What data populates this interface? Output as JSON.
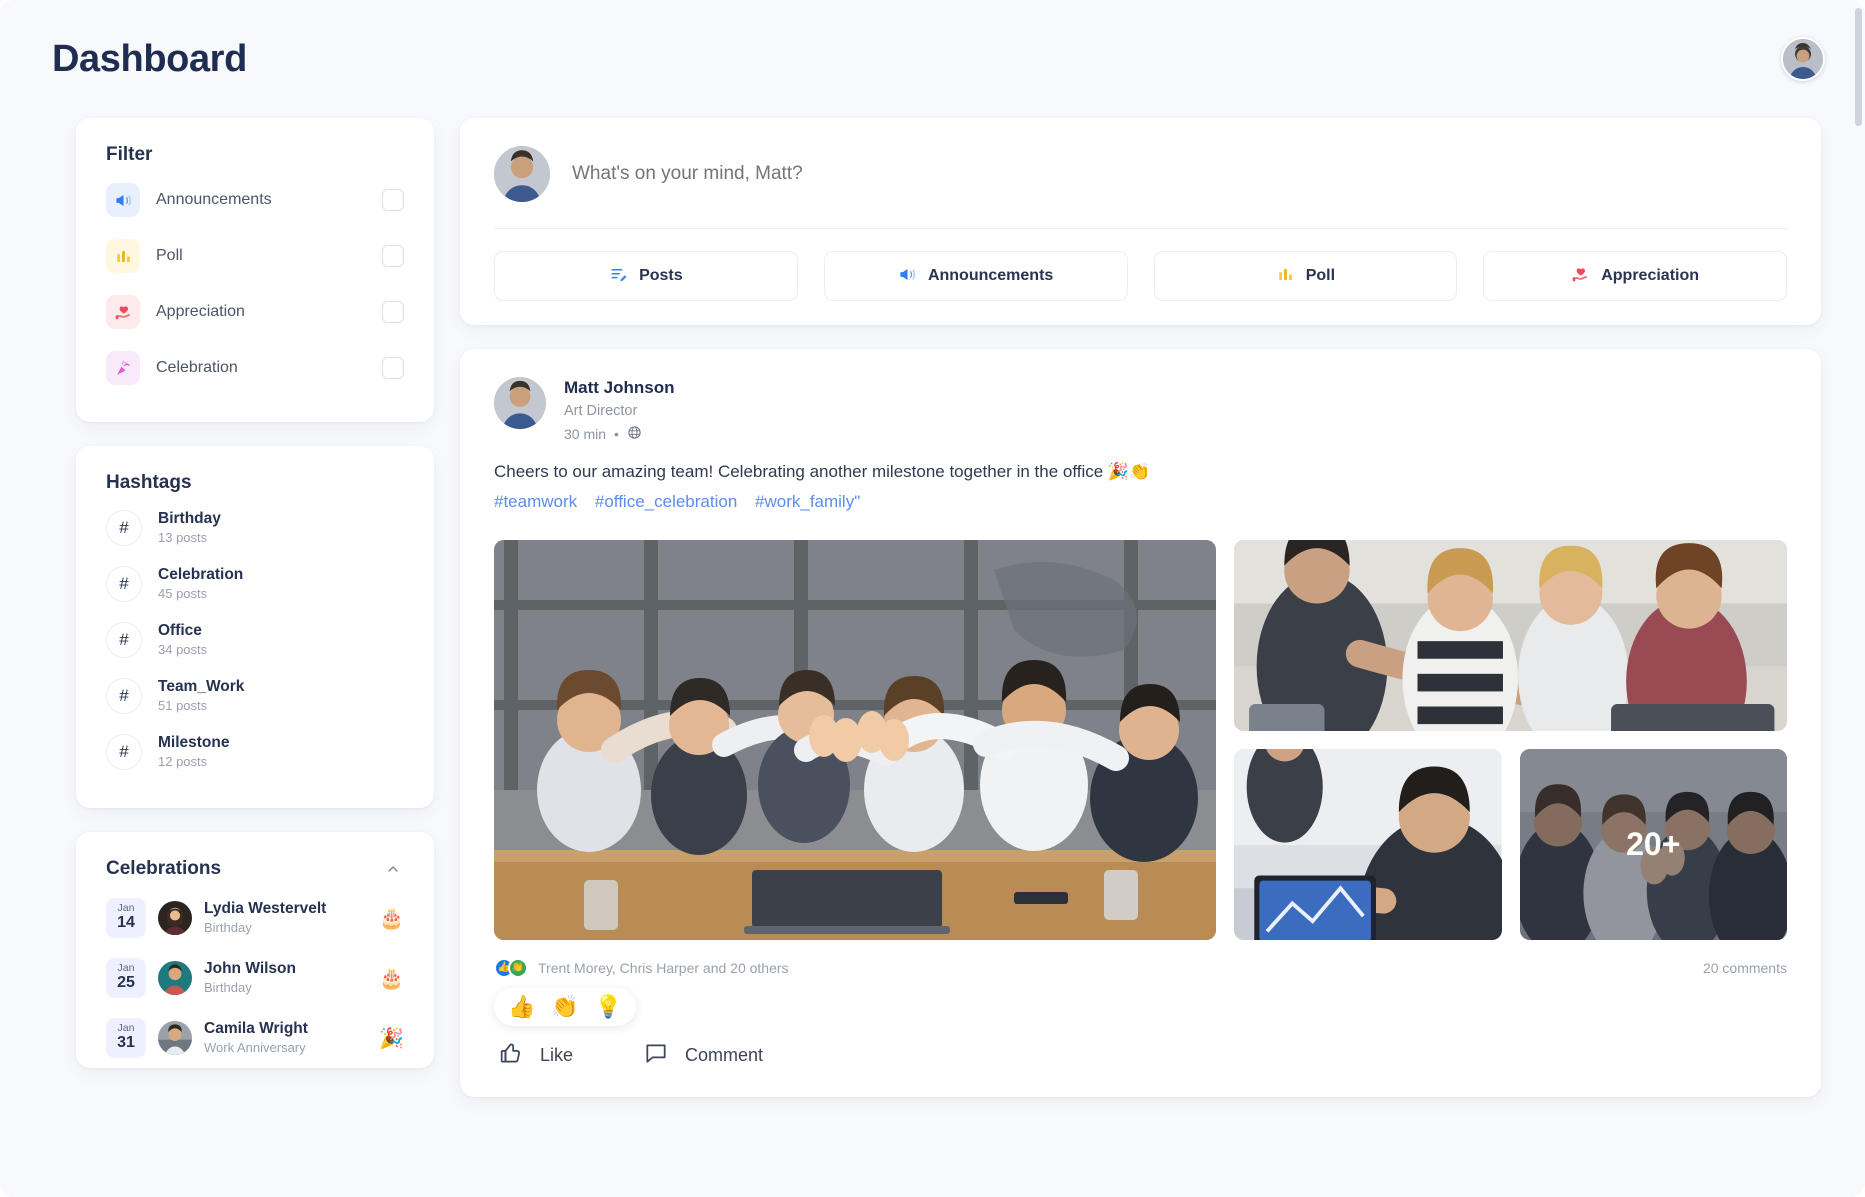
{
  "header": {
    "title": "Dashboard",
    "avatar_alt": "user-avatar"
  },
  "sidebar": {
    "filter": {
      "title": "Filter",
      "items": [
        {
          "label": "Announcements",
          "icon": "megaphone-icon",
          "checked": false
        },
        {
          "label": "Poll",
          "icon": "bar-chart-icon",
          "checked": false
        },
        {
          "label": "Appreciation",
          "icon": "heart-hand-icon",
          "checked": false
        },
        {
          "label": "Celebration",
          "icon": "party-popper-icon",
          "checked": false
        }
      ]
    },
    "hashtags": {
      "title": "Hashtags",
      "symbol": "#",
      "items": [
        {
          "name": "Birthday",
          "count": "13 posts"
        },
        {
          "name": "Celebration",
          "count": "45 posts"
        },
        {
          "name": "Office",
          "count": "34 posts"
        },
        {
          "name": "Team_Work",
          "count": "51 posts"
        },
        {
          "name": "Milestone",
          "count": "12 posts"
        }
      ]
    },
    "celebrations": {
      "title": "Celebrations",
      "collapse_icon": "chevron-up-icon",
      "items": [
        {
          "month": "Jan",
          "day": "14",
          "name": "Lydia Westervelt",
          "occasion": "Birthday",
          "emoji": "🎂"
        },
        {
          "month": "Jan",
          "day": "25",
          "name": "John Wilson",
          "occasion": "Birthday",
          "emoji": "🎂"
        },
        {
          "month": "Jan",
          "day": "31",
          "name": "Camila Wright",
          "occasion": "Work Anniversary",
          "emoji": "🎉"
        }
      ]
    }
  },
  "composer": {
    "placeholder": "What's on your mind, Matt?",
    "value": "",
    "actions": [
      {
        "label": "Posts",
        "icon": "posts-icon"
      },
      {
        "label": "Announcements",
        "icon": "megaphone-icon"
      },
      {
        "label": "Poll",
        "icon": "bar-chart-icon"
      },
      {
        "label": "Appreciation",
        "icon": "heart-hand-icon"
      }
    ]
  },
  "post": {
    "author": "Matt Johnson",
    "role": "Art Director",
    "time": "30 min",
    "separator": "•",
    "audience_icon": "globe-icon",
    "text": "Cheers to our amazing team! Celebrating another milestone together in the office 🎉👏",
    "hashtags": [
      "#teamwork",
      "#office_celebration",
      "#work_family\""
    ],
    "media_more": "20+",
    "reactors_text": "Trent Morey, Chris Harper and 20 others",
    "comments_count": "20 comments",
    "reaction_chips": [
      "👍",
      "👏",
      "💡"
    ],
    "footer_actions": [
      {
        "label": "Like",
        "icon": "thumbs-up-icon"
      },
      {
        "label": "Comment",
        "icon": "comment-bubble-icon"
      }
    ]
  },
  "colors": {
    "accent_blue": "#5b8def",
    "title_navy": "#1f2d50",
    "page_bg": "#f7f9fc"
  }
}
